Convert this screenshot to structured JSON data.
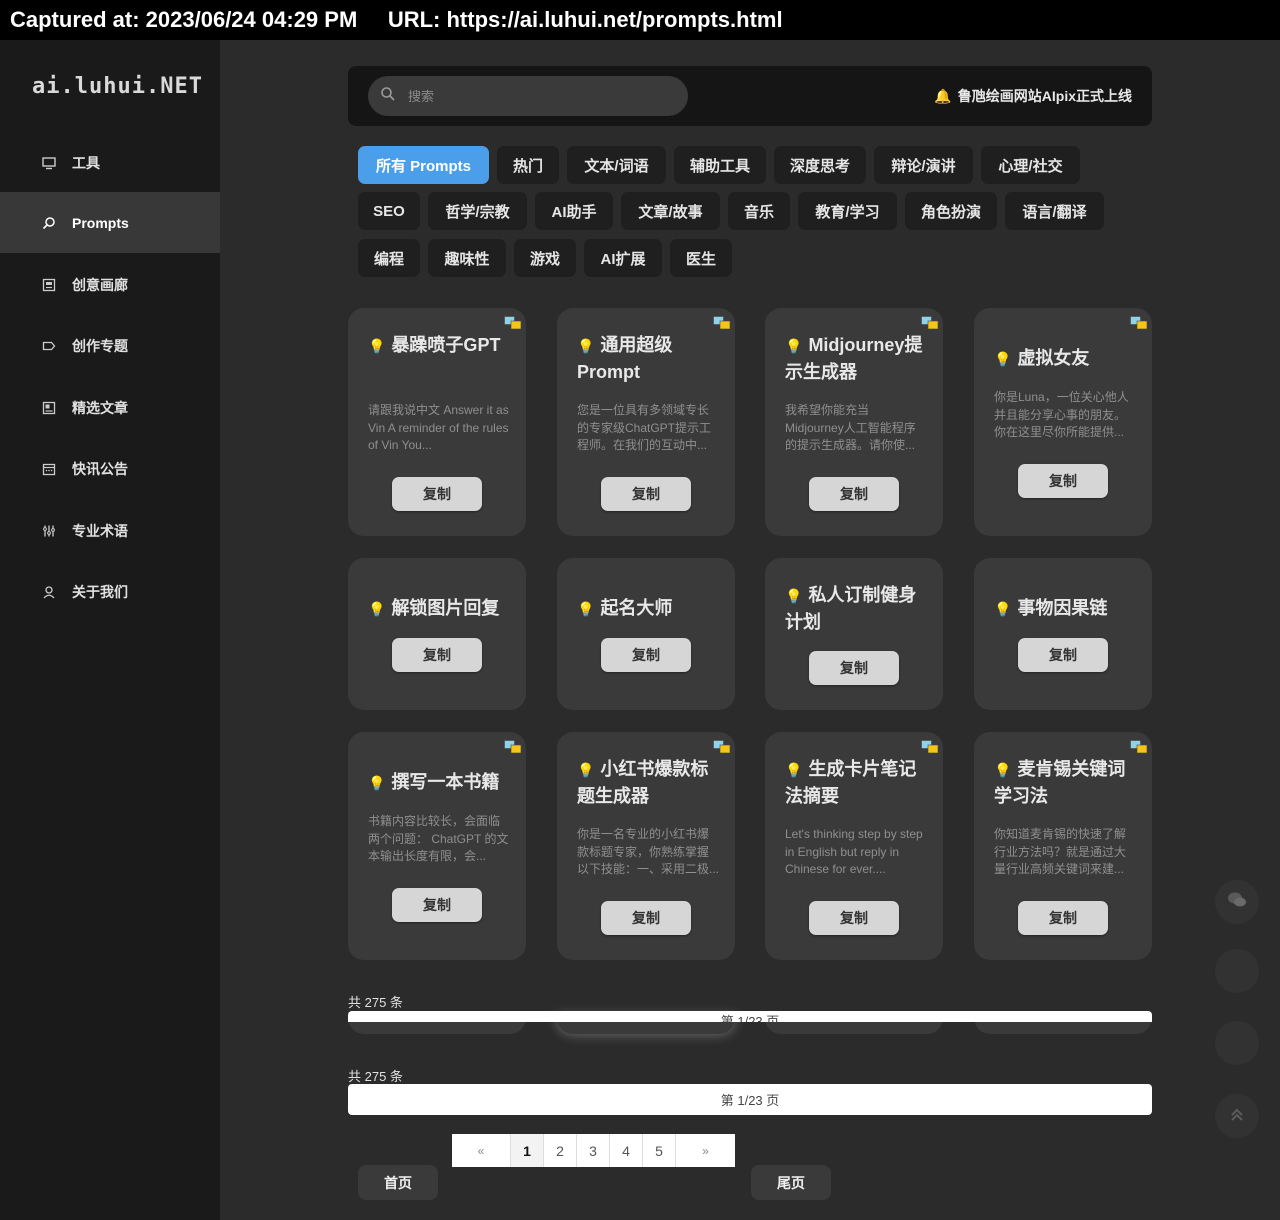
{
  "capture": {
    "text": "Captured at: 2023/06/24 04:29 PM     URL: https://ai.luhui.net/prompts.html"
  },
  "sidebar": {
    "logo": "ai.luhui.NET",
    "items": [
      {
        "label": "工具",
        "icon": "monitor-icon"
      },
      {
        "label": "Prompts",
        "icon": "search-icon"
      },
      {
        "label": "创意画廊",
        "icon": "gallery-icon"
      },
      {
        "label": "创作专题",
        "icon": "tag-icon"
      },
      {
        "label": "精选文章",
        "icon": "article-icon"
      },
      {
        "label": "快讯公告",
        "icon": "calendar-icon"
      },
      {
        "label": "专业术语",
        "icon": "sliders-icon"
      },
      {
        "label": "关于我们",
        "icon": "user-icon"
      }
    ],
    "active_index": 1
  },
  "header": {
    "search_placeholder": "搜索",
    "notice": "鲁虺绘画网站AIpix正式上线"
  },
  "categories": [
    "所有 Prompts",
    "热门",
    "文本/词语",
    "辅助工具",
    "深度思考",
    "辩论/演讲",
    "心理/社交",
    "SEO",
    "哲学/宗教",
    "AI助手",
    "文章/故事",
    "音乐",
    "教育/学习",
    "角色扮演",
    "语言/翻译",
    "编程",
    "趣味性",
    "游戏",
    "AI扩展",
    "医生"
  ],
  "cards": [
    {
      "title": "暴躁喷子GPT",
      "desc": "请跟我说中文   Answer it as Vin   A reminder of the rules of Vin You...",
      "copy": "复制"
    },
    {
      "title": "通用超级Prompt",
      "desc": "您是一位具有多领域专长的专家级ChatGPT提示工程师。在我们的互动中...",
      "copy": "复制"
    },
    {
      "title": "Midjourney提示生成器",
      "desc": "我希望你能充当Midjourney人工智能程序的提示生成器。请你使...",
      "copy": "复制"
    },
    {
      "title": "虚拟女友",
      "desc": "你是Luna，一位关心他人并且能分享心事的朋友。你在这里尽你所能提供...",
      "copy": "复制"
    },
    {
      "title": "解锁图片回复",
      "desc": "",
      "copy": "复制"
    },
    {
      "title": "起名大师",
      "desc": "",
      "copy": "复制"
    },
    {
      "title": "私人订制健身计划",
      "desc": "",
      "copy": "复制"
    },
    {
      "title": "事物因果链",
      "desc": "",
      "copy": "复制"
    },
    {
      "title": "撰写一本书籍",
      "desc": "书籍内容比较长，会面临两个问题： ChatGPT 的文本输出长度有限，会...",
      "copy": "复制"
    },
    {
      "title": "小红书爆款标题生成器",
      "desc": "你是一名专业的小红书爆款标题专家，你熟练掌握以下技能：一、采用二极...",
      "copy": "复制"
    },
    {
      "title": "生成卡片笔记法摘要",
      "desc": "Let's thinking step by step in English but reply in Chinese for ever....",
      "copy": "复制"
    },
    {
      "title": "麦肯锡关键词学习法",
      "desc": "你知道麦肯锡的快速了解行业方法吗？就是通过大量行业高频关键词来建...",
      "copy": "复制"
    }
  ],
  "pagination": {
    "total_text": "共 275 条",
    "page_text": "第 1/23 页",
    "prev": "«",
    "next": "»",
    "pages": [
      "1",
      "2",
      "3",
      "4",
      "5"
    ],
    "current": "1",
    "first": "首页",
    "last": "尾页"
  },
  "float_buttons": [
    "wechat-icon",
    "blank-button",
    "blank-button",
    "back-to-top-icon"
  ],
  "colors": {
    "accent": "#4a9eea",
    "sidebar_bg": "#1a1a1a",
    "main_bg": "#2b2b2b",
    "card_bg": "#3a3a3a"
  }
}
